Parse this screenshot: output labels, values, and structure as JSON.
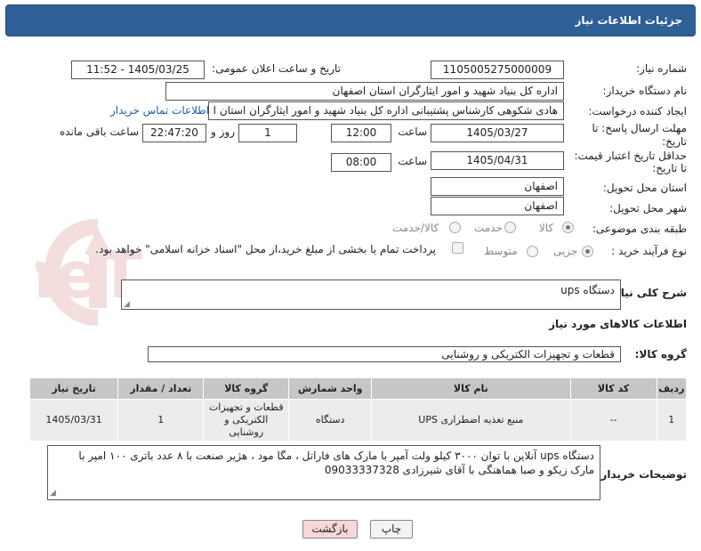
{
  "header": {
    "title": "جزئیات اطلاعات نیاز"
  },
  "watermark": {
    "text": "AriaTender.neT"
  },
  "fields": {
    "need_number_label": "شماره نیاز:",
    "need_number": "1105005275000009",
    "announce_label": "تاریخ و ساعت اعلان عمومی:",
    "announce_value": "1405/03/25 - 11:52",
    "buyer_org_label": "نام دستگاه خریدار:",
    "buyer_org": "اداره کل بنیاد شهید و امور ایثارگران استان اصفهان",
    "creator_label": "ایجاد کننده درخواست:",
    "creator": "هادی شکوهی کارشناس پشتیبانی اداره کل بنیاد شهید و امور ایثارگران استان ا",
    "contact_link": "اطلاعات تماس خریدار",
    "deadline_label_1": "مهلت ارسال پاسخ: تا",
    "deadline_label_2": "تاریخ:",
    "deadline_date": "1405/03/27",
    "time_label": "ساعت",
    "deadline_time": "12:00",
    "days_value": "1",
    "days_label": "روز و",
    "remaining_time": "22:47:20",
    "remaining_label": "ساعت باقی مانده",
    "min_validity_label_1": "حداقل تاریخ اعتبار قیمت:",
    "min_validity_label_2": "تا تاریخ:",
    "validity_date": "1405/04/31",
    "validity_time": "08:00",
    "province_label": "استان محل تحویل:",
    "province": "اصفهان",
    "city_label": "شهر محل تحویل:",
    "city": "اصفهان",
    "category_label": "طبقه بندی موضوعی:",
    "category_options": [
      "کالا",
      "خدمت",
      "کالا/خدمت"
    ],
    "purchase_type_label": "نوع فرآیند خرید :",
    "purchase_options": [
      "جزیی",
      "متوسط"
    ],
    "payment_note": "پرداخت تمام یا بخشی از مبلغ خرید،از محل \"اسناد خزانه اسلامی\" خواهد بود."
  },
  "description": {
    "label": "شرح کلی نیاز:",
    "value": "دستگاه ups"
  },
  "goods_info": {
    "title": "اطلاعات کالاهای مورد نیاز"
  },
  "goods_group": {
    "label": "گروه کالا:",
    "value": "قطعات و تجهیزات الکتریکی و روشنایی"
  },
  "table": {
    "headers": [
      "ردیف",
      "کد کالا",
      "نام کالا",
      "واحد شمارش",
      "گروه کالا",
      "تعداد / مقدار",
      "تاریخ نیاز"
    ],
    "rows": [
      [
        "1",
        "--",
        "منبع تغذیه اضطراری UPS",
        "دستگاه",
        "قطعات و تجهیزات الکتریکی و روشنایی",
        "1",
        "1405/03/31"
      ]
    ]
  },
  "buyer_notes": {
    "label": "توضیحات خریدار:",
    "value": "دستگاه ups آنلاین با توان ۳۰۰۰ کیلو ولت آمپر با مارک های فاراتل ، مگا مود ، هژیر صنعت  با ۸ عدد باتری ۱۰۰ امپر با مارک زیکو و صبا هماهنگی با آقای شیرزادی 09033337328"
  },
  "buttons": {
    "print": "چاپ",
    "back": "بازگشت"
  },
  "colors": {
    "header": "#2e5f96",
    "link": "#1c5db0",
    "back_button": "#f8d7d7",
    "table_header": "#c6c6c6"
  }
}
